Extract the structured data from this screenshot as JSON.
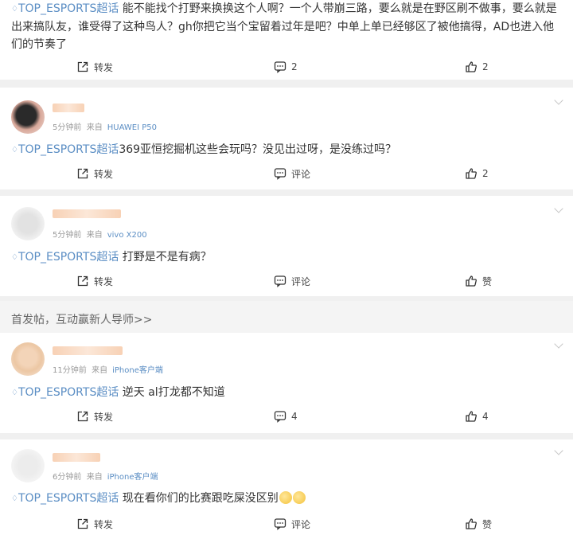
{
  "comments": [
    {
      "tag": "TOP_ESPORTS超话",
      "text": "能不能找个打野来换换这个人啊？一个人带崩三路，要么就是在野区刷不做事，要么就是出来搞队友，谁受得了这种鸟人？gh你把它当个宝留着过年是吧？中单上单已经够区了被他搞得，AD也进入他们的节奏了",
      "repost_label": "转发",
      "comment_count": "2",
      "like_count": "2"
    },
    {
      "time": "5分钟前",
      "from_label": "来自",
      "device": "HUAWEI P50",
      "tag": "TOP_ESPORTS超话",
      "text": "369亚恒挖掘机这些会玩吗？没见出过呀，是没练过吗？",
      "repost_label": "转发",
      "comment_label": "评论",
      "like_count": "2"
    },
    {
      "time": "5分钟前",
      "from_label": "来自",
      "device": "vivo X200",
      "tag": "TOP_ESPORTS超话",
      "text": "打野是不是有病？",
      "repost_label": "转发",
      "comment_label": "评论",
      "like_label": "赞"
    },
    {
      "time": "11分钟前",
      "from_label": "来自",
      "device": "iPhone客户端",
      "tag": "TOP_ESPORTS超话",
      "text": "逆天 al打龙都不知道",
      "repost_label": "转发",
      "comment_count": "4",
      "like_count": "4"
    },
    {
      "time": "6分钟前",
      "from_label": "来自",
      "device": "iPhone客户端",
      "tag": "TOP_ESPORTS超话",
      "text": "现在看你们的比赛跟吃屎没区别",
      "repost_label": "转发",
      "comment_label": "评论",
      "like_label": "赞"
    }
  ],
  "notice": {
    "text": "首发帖，互动赢新人导师>>"
  },
  "icons": {
    "tag": "diamond-icon",
    "repost": "share-icon",
    "comment": "comment-icon",
    "like": "thumbs-up-icon",
    "menu": "chevron-down-icon",
    "emoji": "smile-emoji-icon"
  },
  "colors": {
    "link": "#5b8ec4",
    "background": "#f0f0f0",
    "card": "#ffffff"
  }
}
